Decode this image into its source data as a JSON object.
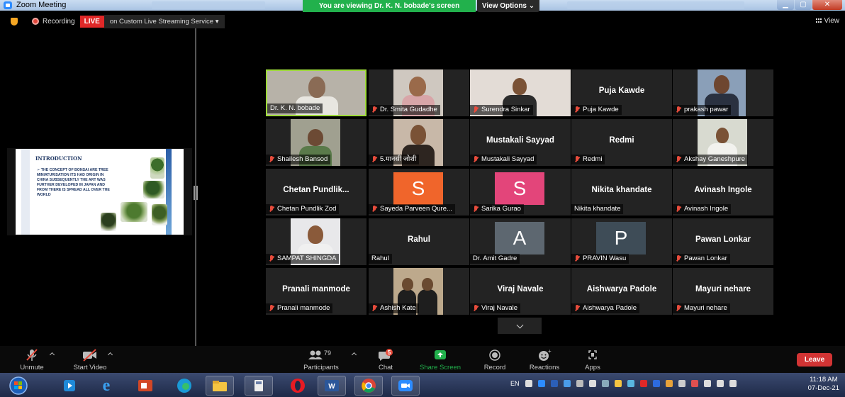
{
  "titlebar": {
    "app_title": "Zoom Meeting",
    "share_banner": "You are viewing Dr. K. N. bobade's screen",
    "view_options": "View Options ⌄"
  },
  "recording": {
    "label": "Recording",
    "live": "LIVE",
    "stream": "on Custom Live Streaming Service ▾"
  },
  "view_button": "View",
  "slide": {
    "title": "INTRODUCTION",
    "text": "➢ THE CONCEPT OF BONSAI ARE TREE MINIATURISATION ITS HAD ORIGIN IN CHINA SUBSEQUENTLY THE ART WAS FURTHER DEVELOPED IN JAPAN AND FROM THERE IS SPREAD ALL OVER THE WORLD"
  },
  "participants_grid": [
    {
      "kind": "video",
      "label": "Dr. K. N. bobade",
      "muted": false,
      "active": true
    },
    {
      "kind": "video",
      "label": "Dr. Smita Gudadhe",
      "muted": true
    },
    {
      "kind": "video",
      "label": "Surendra Sinkar",
      "muted": true
    },
    {
      "kind": "name",
      "big_name": "Puja Kawde",
      "label": "Puja Kawde",
      "muted": true
    },
    {
      "kind": "video",
      "label": "prakash pawar",
      "muted": true
    },
    {
      "kind": "video",
      "label": "Shailesh Bansod",
      "muted": true
    },
    {
      "kind": "video",
      "label": "5.मानसी जोशी",
      "muted": true
    },
    {
      "kind": "name",
      "big_name": "Mustakali Sayyad",
      "label": "Mustakali Sayyad",
      "muted": true
    },
    {
      "kind": "name",
      "big_name": "Redmi",
      "label": "Redmi",
      "muted": true
    },
    {
      "kind": "video",
      "label": "Akshay Ganeshpure",
      "muted": true
    },
    {
      "kind": "name",
      "big_name": "Chetan  Pundlik...",
      "label": "Chetan Pundlik Zod",
      "muted": true
    },
    {
      "kind": "avatar",
      "letter": "S",
      "color": "#f0652b",
      "label": "Sayeda Parveen Qure...",
      "muted": true
    },
    {
      "kind": "avatar",
      "letter": "S",
      "color": "#e3457a",
      "label": "Sarika Gurao",
      "muted": true
    },
    {
      "kind": "name",
      "big_name": "Nikita khandate",
      "label": "Nikita khandate",
      "muted": false
    },
    {
      "kind": "name",
      "big_name": "Avinash Ingole",
      "label": "Avinash Ingole",
      "muted": true
    },
    {
      "kind": "video",
      "label": "SAMPAT SHINGDA",
      "muted": true
    },
    {
      "kind": "name",
      "big_name": "Rahul",
      "label": "Rahul",
      "muted": false
    },
    {
      "kind": "avatar",
      "letter": "A",
      "color": "#5d6770",
      "label": "Dr. Amit Gadre",
      "muted": false
    },
    {
      "kind": "avatar",
      "letter": "P",
      "color": "#3e4c57",
      "label": "PRAVIN Wasu",
      "muted": true
    },
    {
      "kind": "name",
      "big_name": "Pawan Lonkar",
      "label": "Pawan Lonkar",
      "muted": true
    },
    {
      "kind": "name",
      "big_name": "Pranali manmode",
      "label": "Pranali manmode",
      "muted": true
    },
    {
      "kind": "video",
      "label": "Ashish Kate",
      "muted": true
    },
    {
      "kind": "name",
      "big_name": "Viraj Navale",
      "label": "Viraj Navale",
      "muted": true
    },
    {
      "kind": "name",
      "big_name": "Aishwarya Padole",
      "label": "Aishwarya Padole",
      "muted": true
    },
    {
      "kind": "name",
      "big_name": "Mayuri nehare",
      "label": "Mayuri nehare",
      "muted": true
    }
  ],
  "controls": {
    "unmute": "Unmute",
    "start_video": "Start Video",
    "participants": "Participants",
    "participants_count": "79",
    "chat": "Chat",
    "chat_badge": "5",
    "share_screen": "Share Screen",
    "record": "Record",
    "reactions": "Reactions",
    "apps": "Apps",
    "leave": "Leave"
  },
  "taskbar": {
    "lang": "EN",
    "time": "11:18 AM",
    "date": "07-Dec-21"
  },
  "colors": {
    "share_green": "#22b14c",
    "live_red": "#e02828",
    "leave_red": "#d23434",
    "active_border": "#9fdc3b"
  }
}
